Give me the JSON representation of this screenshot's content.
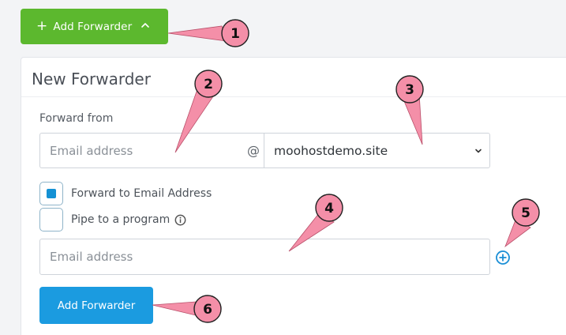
{
  "toolbar": {
    "add_forwarder_toggle_label": "Add Forwarder"
  },
  "form": {
    "title": "New Forwarder",
    "forward_from_label": "Forward from",
    "email_from_placeholder": "Email address",
    "at_symbol": "@",
    "domain_selected": "moohostdemo.site",
    "options": [
      {
        "label": "Forward to Email Address",
        "checked": true
      },
      {
        "label": "Pipe to a program",
        "checked": false
      }
    ],
    "email_to_placeholder": "Email address",
    "submit_label": "Add Forwarder"
  },
  "annotations": [
    "1",
    "2",
    "3",
    "4",
    "5",
    "6"
  ],
  "colors": {
    "primary_green": "#5cb82e",
    "primary_blue": "#1b9be0",
    "accent_blue": "#1491d4",
    "annotation_pink": "#f48fa8"
  }
}
